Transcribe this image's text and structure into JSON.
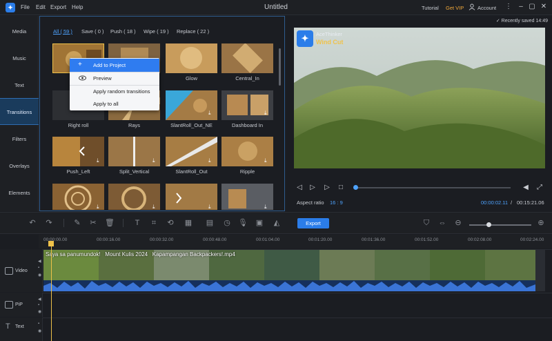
{
  "app": {
    "logo": "AceThinker-logo",
    "menu": [
      "File",
      "Edit",
      "Export",
      "Help"
    ],
    "title": "Untitled",
    "tutorial": "Tutorial",
    "get_vip": "Get VIP",
    "account": "Account"
  },
  "nav": {
    "items": [
      {
        "label": "Media"
      },
      {
        "label": "Music"
      },
      {
        "label": "Text"
      },
      {
        "label": "Transitions"
      },
      {
        "label": "Filters"
      },
      {
        "label": "Overlays"
      },
      {
        "label": "Elements"
      }
    ],
    "active": "Transitions"
  },
  "library": {
    "tabs": [
      {
        "label": "All ( 59 )"
      },
      {
        "label": "Save ( 0 )"
      },
      {
        "label": "Push ( 18 )"
      },
      {
        "label": "Wipe ( 19 )"
      },
      {
        "label": "Replace ( 22 )"
      }
    ],
    "thumbs": [
      {
        "label": ""
      },
      {
        "label": ""
      },
      {
        "label": "Glow"
      },
      {
        "label": "Central_In"
      },
      {
        "label": "Right roll"
      },
      {
        "label": "Rays"
      },
      {
        "label": "SlantRoll_Out_NE"
      },
      {
        "label": "Dashboard In"
      },
      {
        "label": "Push_Left"
      },
      {
        "label": "Split_Vertical"
      },
      {
        "label": "SlantRoll_Out"
      },
      {
        "label": "Ripple"
      },
      {
        "label": ""
      },
      {
        "label": ""
      },
      {
        "label": ""
      },
      {
        "label": ""
      }
    ]
  },
  "context_menu": {
    "items": [
      "Add to Project",
      "Preview",
      "Apply random transitions",
      "Apply to all"
    ]
  },
  "preview": {
    "saved": "Recently saved 14:49",
    "watermark_brand": "AceThinker",
    "watermark_product": "Wind Cut",
    "aspect_label": "Aspect ratio",
    "aspect_value": "16 : 9",
    "time_current": "00:00:02.11",
    "time_sep": "/",
    "time_total": "00:15:21.06"
  },
  "toolbar": {
    "export_label": "Export"
  },
  "timeline": {
    "ticks": [
      "00:00:00.00",
      "00:00:16.00",
      "00:00:32.00",
      "00:00:48.00",
      "00:01:04.00",
      "00:01:20.00",
      "00:01:36.00",
      "00:01:52.00",
      "00:02:08.00",
      "00:02:24.00"
    ],
    "tracks": [
      {
        "label": "Video"
      },
      {
        "label": "PiP"
      },
      {
        "label": "Text"
      }
    ],
    "clip_title": "Saya sa panumundok!   Mount Kulis 2024   Kapampangan Backpackers!.mp4"
  }
}
